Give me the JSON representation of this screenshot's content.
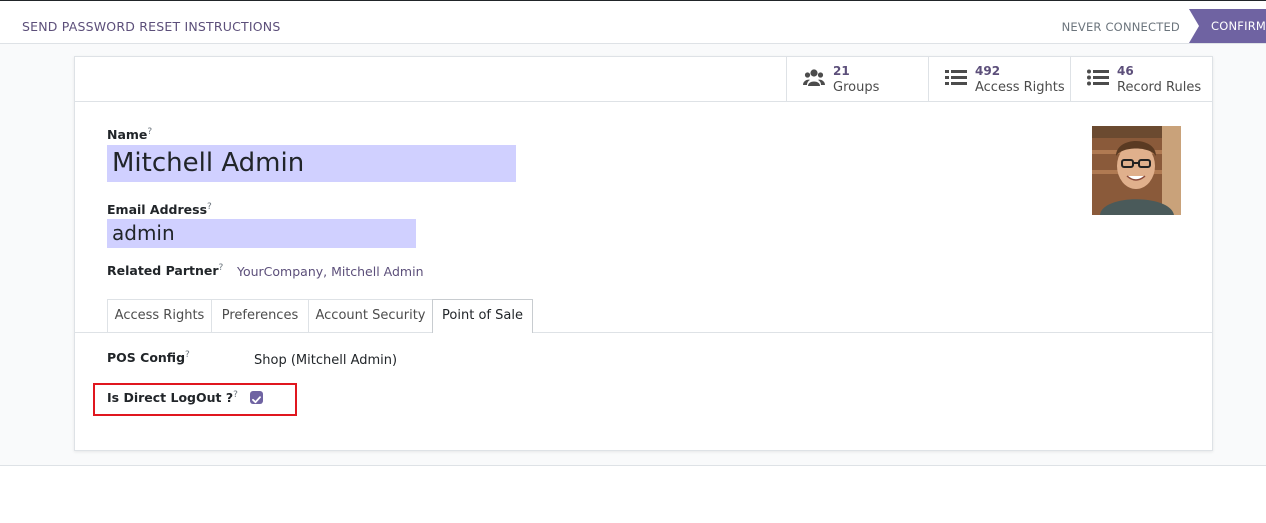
{
  "status_bar": {
    "send_reset_label": "SEND PASSWORD RESET INSTRUCTIONS",
    "stages": [
      "NEVER CONNECTED",
      "CONFIRM"
    ],
    "active_color": "#6f63a2"
  },
  "smart_buttons": [
    {
      "value": "21",
      "label": "Groups",
      "icon": "users-icon"
    },
    {
      "value": "492",
      "label": "Access Rights",
      "icon": "list-icon"
    },
    {
      "value": "46",
      "label": "Record Rules",
      "icon": "list-icon"
    }
  ],
  "form": {
    "name_label": "Name",
    "name_value": "Mitchell Admin",
    "email_label": "Email Address",
    "email_value": "admin",
    "partner_label": "Related Partner",
    "partner_value": "YourCompany, Mitchell Admin",
    "help_mark": "?"
  },
  "tabs": [
    "Access Rights",
    "Preferences",
    "Account Security",
    "Point of Sale"
  ],
  "active_tab": "Point of Sale",
  "pos_tab": {
    "pos_config_label": "POS Config",
    "pos_config_value": "Shop (Mitchell Admin)",
    "direct_logout_label": "Is Direct LogOut ?",
    "direct_logout_checked": true
  }
}
